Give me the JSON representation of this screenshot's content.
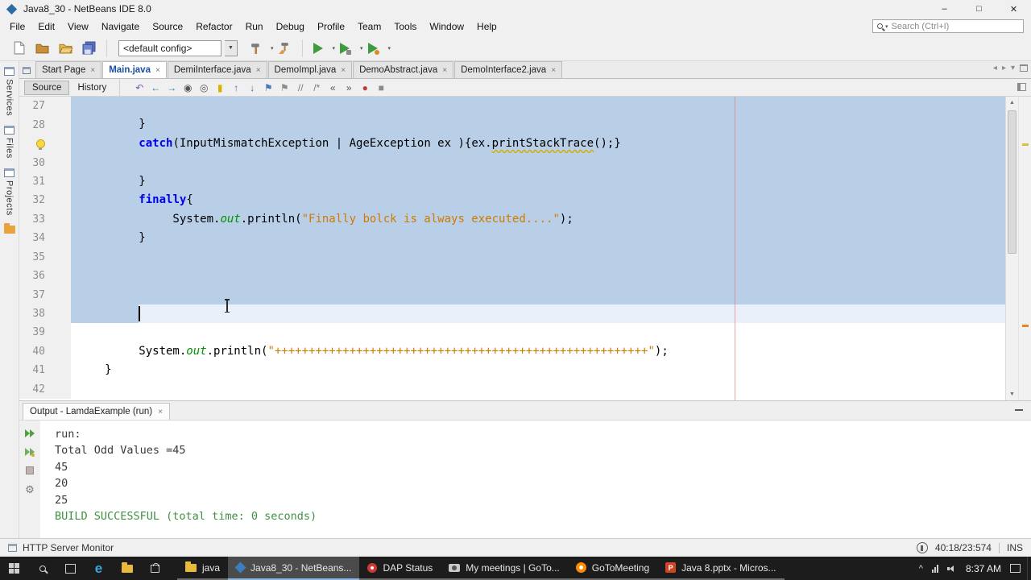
{
  "window": {
    "title": "Java8_30 - NetBeans IDE 8.0",
    "controls": {
      "min": "–",
      "max": "□",
      "close": "✕"
    }
  },
  "menu": {
    "items": [
      "File",
      "Edit",
      "View",
      "Navigate",
      "Source",
      "Refactor",
      "Run",
      "Debug",
      "Profile",
      "Team",
      "Tools",
      "Window",
      "Help"
    ]
  },
  "search": {
    "placeholder": "Search (Ctrl+I)"
  },
  "toolbar": {
    "config": "<default config>"
  },
  "dock": {
    "items": [
      "Services",
      "Files",
      "Projects"
    ]
  },
  "tabs": [
    {
      "label": "Start Page",
      "active": false
    },
    {
      "label": "Main.java",
      "active": true
    },
    {
      "label": "DemiInterface.java",
      "active": false
    },
    {
      "label": "DemoImpl.java",
      "active": false
    },
    {
      "label": "DemoAbstract.java",
      "active": false
    },
    {
      "label": "DemoInterface2.java",
      "active": false
    }
  ],
  "editor_toolbar": {
    "source": "Source",
    "history": "History",
    "icons": [
      {
        "name": "last-edit-location-icon",
        "glyph": "↶",
        "color": "#7d5bb5"
      },
      {
        "name": "back-icon",
        "glyph": "←",
        "color": "#1f7fa8"
      },
      {
        "name": "forward-icon",
        "glyph": "→",
        "color": "#1f7fa8"
      },
      {
        "name": "find-selection-icon",
        "glyph": "◉",
        "color": "#555555"
      },
      {
        "name": "find-next-occurrence-icon",
        "glyph": "◎",
        "color": "#555555"
      },
      {
        "name": "toggle-highlight-search-icon",
        "glyph": "▮",
        "color": "#d6b300"
      },
      {
        "name": "previous-occurrence-icon",
        "glyph": "↑",
        "color": "#3d6fb0"
      },
      {
        "name": "next-occurrence-icon",
        "glyph": "↓",
        "color": "#3d6fb0"
      },
      {
        "name": "toggle-bookmark-icon",
        "glyph": "⚑",
        "color": "#4a78c0"
      },
      {
        "name": "next-bookmark-icon",
        "glyph": "⚑",
        "color": "#8a8a8a"
      },
      {
        "name": "comment-icon",
        "glyph": "//",
        "color": "#7a7a7a"
      },
      {
        "name": "uncomment-icon",
        "glyph": "/*",
        "color": "#7a7a7a"
      },
      {
        "name": "shift-left-icon",
        "glyph": "«",
        "color": "#555555"
      },
      {
        "name": "shift-right-icon",
        "glyph": "»",
        "color": "#555555"
      },
      {
        "name": "start-macro-recording-icon",
        "glyph": "●",
        "color": "#c23b3b"
      },
      {
        "name": "stop-macro-recording-icon",
        "glyph": "■",
        "color": "#8a8a8a"
      }
    ]
  },
  "code": {
    "lines": [
      {
        "no": "27",
        "segs": [],
        "sel": "full"
      },
      {
        "no": "28",
        "segs": [
          {
            "t": "          }"
          }
        ],
        "sel": "full"
      },
      {
        "no": "29",
        "icon": "warning",
        "segs": [
          {
            "t": "          "
          },
          {
            "t": "catch",
            "c": "kw"
          },
          {
            "t": "(InputMismatchException | AgeException ex ){ex."
          },
          {
            "t": "printStackTrace",
            "c": "warn"
          },
          {
            "t": "();}"
          }
        ],
        "sel": "full"
      },
      {
        "no": "30",
        "segs": [],
        "sel": "full"
      },
      {
        "no": "31",
        "segs": [
          {
            "t": "          }"
          }
        ],
        "sel": "full"
      },
      {
        "no": "32",
        "segs": [
          {
            "t": "          "
          },
          {
            "t": "finally",
            "c": "kw"
          },
          {
            "t": "{"
          }
        ],
        "sel": "full"
      },
      {
        "no": "33",
        "segs": [
          {
            "t": "               System."
          },
          {
            "t": "out",
            "c": "field"
          },
          {
            "t": ".println("
          },
          {
            "t": "\"Finally bolck is always executed....\"",
            "c": "str"
          },
          {
            "t": ");"
          }
        ],
        "sel": "full"
      },
      {
        "no": "34",
        "segs": [
          {
            "t": "          }"
          }
        ],
        "sel": "full"
      },
      {
        "no": "35",
        "segs": [],
        "sel": "full"
      },
      {
        "no": "36",
        "segs": [],
        "sel": "full"
      },
      {
        "no": "37",
        "segs": [],
        "sel": "full"
      },
      {
        "no": "38",
        "segs": [],
        "sel": "caret"
      },
      {
        "no": "39",
        "segs": [],
        "sel": "none"
      },
      {
        "no": "40",
        "segs": [
          {
            "t": "          System."
          },
          {
            "t": "out",
            "c": "field"
          },
          {
            "t": ".println("
          },
          {
            "t": "\"+++++++++++++++++++++++++++++++++++++++++++++++++++++++\"",
            "c": "str"
          },
          {
            "t": ");"
          }
        ],
        "sel": "none"
      },
      {
        "no": "41",
        "segs": [
          {
            "t": "     }"
          }
        ],
        "sel": "none"
      },
      {
        "no": "42",
        "segs": [],
        "sel": "none"
      }
    ]
  },
  "output": {
    "tab": "Output - LamdaExample (run)",
    "lines": [
      {
        "text": "run:",
        "type": "plain"
      },
      {
        "text": "Total Odd Values =45",
        "type": "plain"
      },
      {
        "text": "45",
        "type": "plain"
      },
      {
        "text": "20",
        "type": "plain"
      },
      {
        "text": "25",
        "type": "plain"
      },
      {
        "text": "BUILD SUCCESSFUL (total time: 0 seconds)",
        "type": "success"
      }
    ]
  },
  "status": {
    "left": "HTTP Server Monitor",
    "caret": "40:18/23:574",
    "mode": "INS"
  },
  "taskbar": {
    "apps": [
      {
        "label": "java",
        "icon": "folder",
        "active": false
      },
      {
        "label": "Java8_30 - NetBeans...",
        "icon": "netbeans",
        "active": true
      },
      {
        "label": "DAP Status",
        "icon": "dap",
        "active": false
      },
      {
        "label": "My meetings | GoTo...",
        "icon": "camera",
        "active": false
      },
      {
        "label": "GoToMeeting",
        "icon": "goto",
        "active": false
      },
      {
        "label": "Java 8.pptx - Micros...",
        "icon": "powerpoint",
        "active": false
      }
    ],
    "time": "8:37 AM"
  },
  "icons": {
    "close": "×",
    "up": "▲",
    "down": "▼",
    "left": "◂",
    "right": "▸",
    "drop": "▾",
    "chevron": "^",
    "edge": "e",
    "ppt": "P"
  },
  "colors": {
    "selection": "#b9cfe8",
    "keyword": "#0000e6",
    "string": "#ce7b00",
    "field": "#009300",
    "success": "#3e9141",
    "margin_line": "#e06e6e",
    "taskbar_bg": "#1c1c1c"
  }
}
